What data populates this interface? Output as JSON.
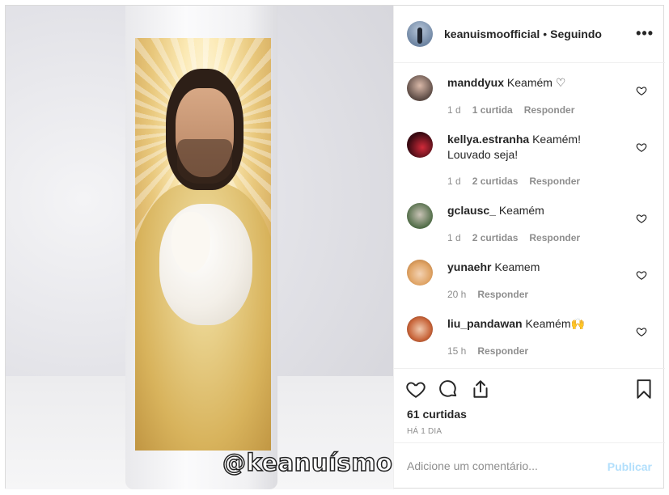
{
  "photo": {
    "watermark": "@keanuísmo"
  },
  "header": {
    "username": "keanuismoofficial",
    "separator": "•",
    "follow_status": "Seguindo",
    "more_icon": "ellipsis-icon"
  },
  "comments": [
    {
      "username": "manddyux",
      "text": "Keamém ♡",
      "time": "1 d",
      "likes": "1 curtida",
      "reply": "Responder",
      "avatar_color": "#5b4a44"
    },
    {
      "username": "kellya.estranha",
      "text": "Keamém! Louvado seja!",
      "time": "1 d",
      "likes": "2 curtidas",
      "reply": "Responder",
      "avatar_color": "#5c1320"
    },
    {
      "username": "gclausc_",
      "text": "Keamém",
      "time": "1 d",
      "likes": "2 curtidas",
      "reply": "Responder",
      "avatar_color": "#4f6b46"
    },
    {
      "username": "yunaehr",
      "text": "Keamem",
      "time": "20 h",
      "likes": "",
      "reply": "Responder",
      "avatar_color": "#e0a567"
    },
    {
      "username": "liu_pandawan",
      "text": "Keamém🙌",
      "time": "15 h",
      "likes": "",
      "reply": "Responder",
      "avatar_color": "#c8653a"
    }
  ],
  "actions": {
    "like_icon": "heart-icon",
    "comment_icon": "comment-icon",
    "share_icon": "share-icon",
    "save_icon": "bookmark-icon",
    "likes_count": "61 curtidas",
    "posted_time": "HÁ 1 DIA"
  },
  "add_comment": {
    "placeholder": "Adicione um comentário...",
    "post_label": "Publicar"
  },
  "colors": {
    "text": "#262626",
    "meta": "#8e8e8e",
    "border": "#dbdbdb",
    "post_disabled": "#b2dffc"
  }
}
